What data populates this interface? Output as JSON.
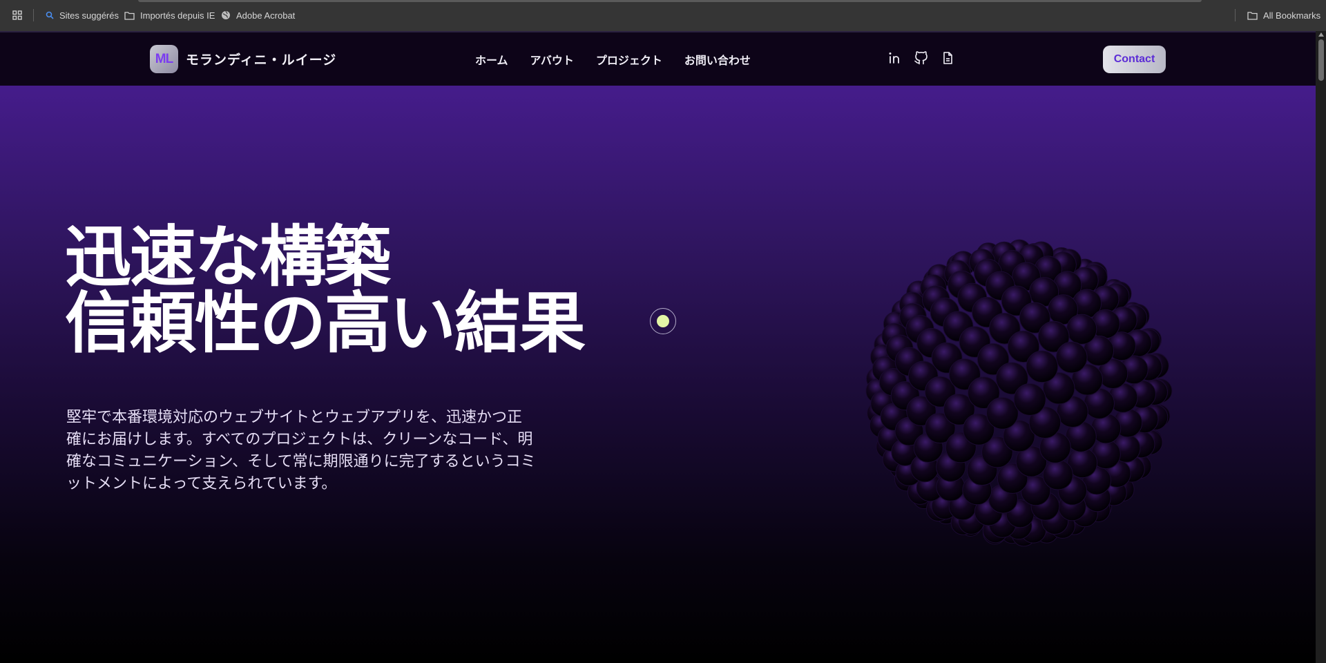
{
  "browser": {
    "bookmarks": [
      {
        "label": "Sites suggérés",
        "icon": "search-icon"
      },
      {
        "label": "Importés depuis IE",
        "icon": "folder-icon"
      },
      {
        "label": "Adobe Acrobat",
        "icon": "globe-icon"
      }
    ],
    "all_bookmarks": "All Bookmarks"
  },
  "nav": {
    "logo": "ML",
    "brand": "モランディニ・ルイージ",
    "links": [
      "ホーム",
      "アバウト",
      "プロジェクト",
      "お問い合わせ"
    ],
    "social": [
      "linkedin-icon",
      "github-icon",
      "resume-icon"
    ],
    "contact": "Contact"
  },
  "hero": {
    "headline_line1": "迅速な構築",
    "headline_line2": "信頼性の高い結果",
    "description": "堅牢で本番環境対応のウェブサイトとウェブアプリを、迅速かつ正確にお届けします。すべてのプロジェクトは、クリーンなコード、明確なコミュニケーション、そして常に期限通りに完了するというコミットメントによって支えられています。"
  },
  "colors": {
    "accent": "#7b3cf0",
    "cursor": "#e3f5a6",
    "nav_bg": "#0d0418",
    "hero_top": "#451c8b"
  }
}
